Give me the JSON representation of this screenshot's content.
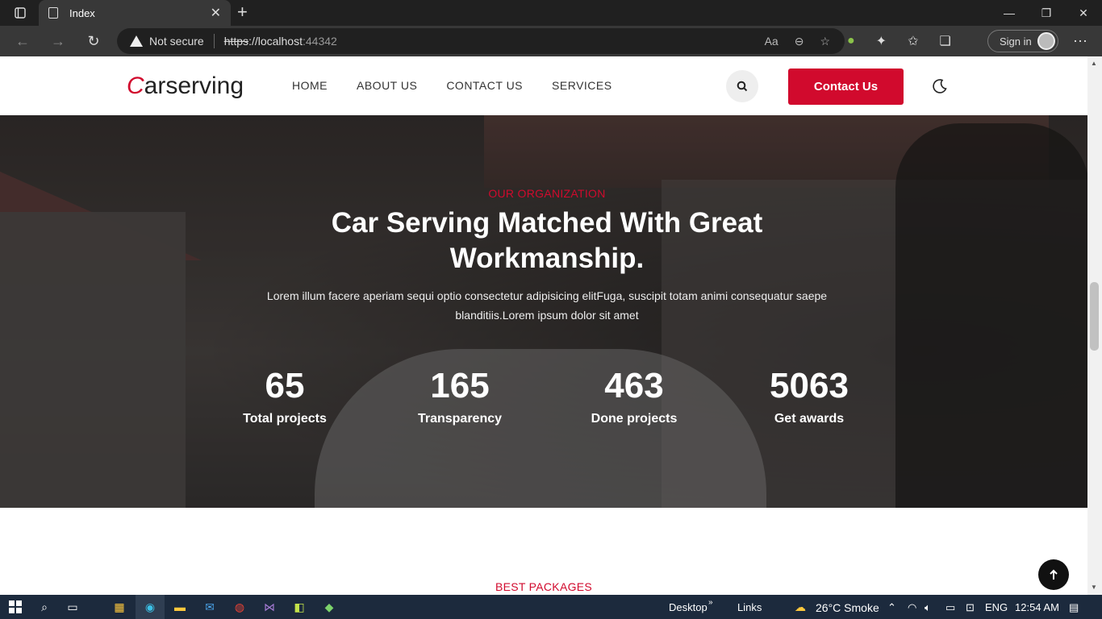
{
  "browser": {
    "tab_title": "Index",
    "new_tab_glyph": "+",
    "security_label": "Not secure",
    "url_scheme": "https",
    "url_host": "://localhost",
    "url_port": ":44342",
    "signin_label": "Sign in"
  },
  "site": {
    "logo_initial": "C",
    "logo_rest": "arserving",
    "menu": [
      "HOME",
      "ABOUT US",
      "CONTACT US",
      "SERVICES"
    ],
    "cta_label": "Contact Us",
    "accent_color": "#d10a2d"
  },
  "hero": {
    "kicker": "OUR ORGANIZATION",
    "headline": "Car Serving Matched With Great Workmanship.",
    "lede": "Lorem illum facere aperiam sequi optio consectetur adipisicing elitFuga, suscipit totam animi consequatur saepe blanditiis.Lorem ipsum dolor sit amet",
    "stats": [
      {
        "value": "65",
        "label": "Total projects"
      },
      {
        "value": "165",
        "label": "Transparency"
      },
      {
        "value": "463",
        "label": "Done projects"
      },
      {
        "value": "5063",
        "label": "Get awards"
      }
    ]
  },
  "next_section": {
    "kicker": "BEST PACKAGES"
  },
  "taskbar": {
    "desktop_label": "Desktop",
    "links_label": "Links",
    "weather": "26°C  Smoke",
    "language": "ENG",
    "time": "12:54 AM"
  }
}
